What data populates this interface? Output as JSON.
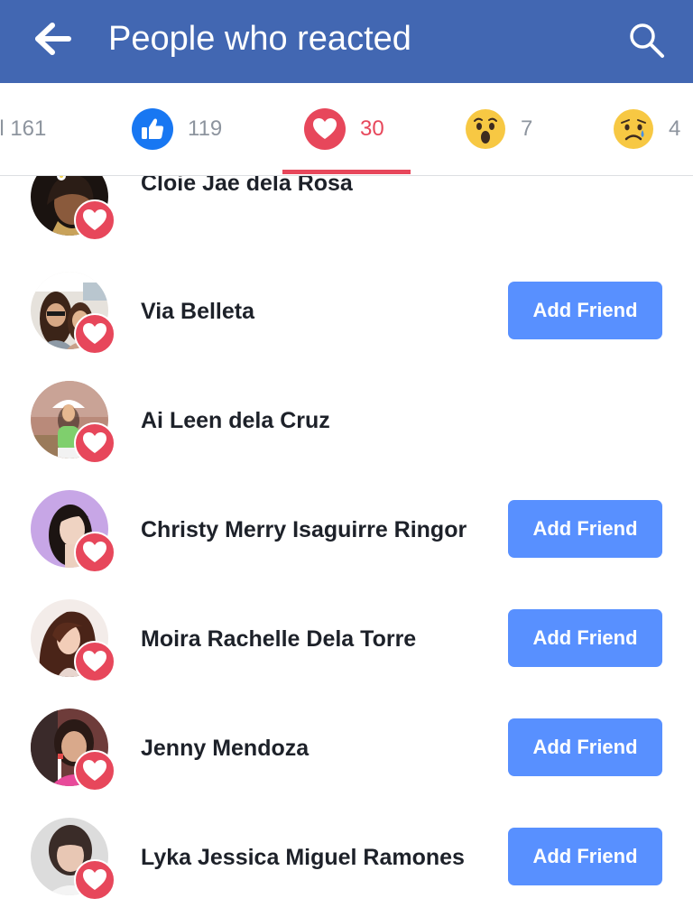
{
  "header": {
    "title": "People who reacted",
    "background_color": "#4267b2",
    "back_icon": "back-arrow-icon",
    "search_icon": "search-icon"
  },
  "tabs": [
    {
      "id": "all",
      "label": "All",
      "count": "161",
      "visible_text": "ll 161",
      "active": false
    },
    {
      "id": "like",
      "icon": "like-icon",
      "count": "119",
      "active": false
    },
    {
      "id": "love",
      "icon": "love-icon",
      "count": "30",
      "active": true
    },
    {
      "id": "wow",
      "icon": "wow-icon",
      "count": "7",
      "active": false
    },
    {
      "id": "sad",
      "icon": "sad-icon",
      "count": "4",
      "active": false
    }
  ],
  "active_tab_color": "#e7475b",
  "people": [
    {
      "name": "Cloie Jae dela Rosa",
      "add_friend": false,
      "reaction": "love-icon"
    },
    {
      "name": "Via Belleta",
      "add_friend": true,
      "reaction": "love-icon"
    },
    {
      "name": "Ai Leen dela Cruz",
      "add_friend": false,
      "reaction": "love-icon"
    },
    {
      "name": "Christy Merry Isaguirre Ringor",
      "add_friend": true,
      "reaction": "love-icon"
    },
    {
      "name": "Moira Rachelle Dela Torre",
      "add_friend": true,
      "reaction": "love-icon"
    },
    {
      "name": "Jenny Mendoza",
      "add_friend": true,
      "reaction": "love-icon"
    },
    {
      "name": "Lyka Jessica Miguel Ramones",
      "add_friend": true,
      "reaction": "love-icon"
    }
  ],
  "add_friend_label": "Add Friend",
  "add_friend_color": "#5890ff"
}
